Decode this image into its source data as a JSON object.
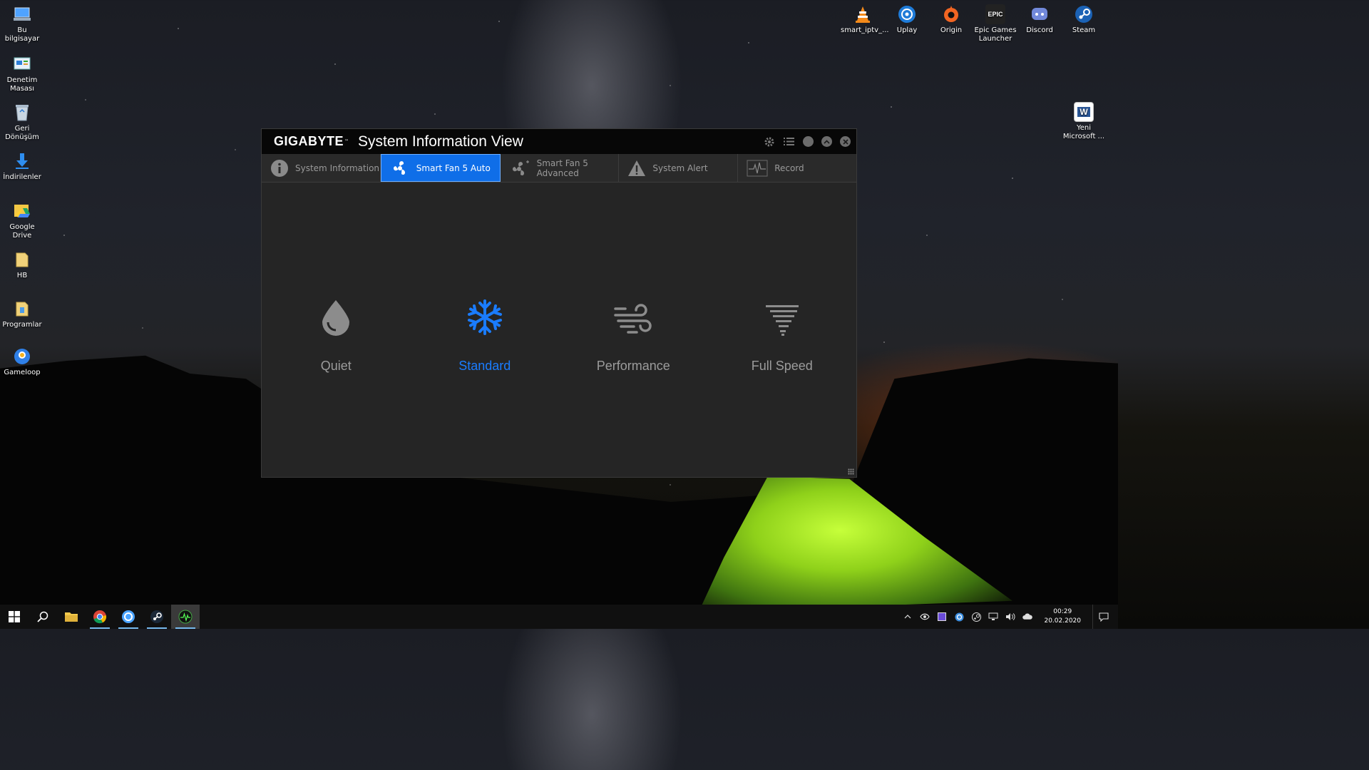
{
  "desktop": {
    "left_icons": [
      {
        "label": "Bu bilgisayar",
        "icon": "computer-icon"
      },
      {
        "label": "Denetim Masası",
        "icon": "control-panel-icon"
      },
      {
        "label": "Geri Dönüşüm",
        "icon": "recycle-bin-icon"
      },
      {
        "label": "İndirilenler",
        "icon": "downloads-icon"
      },
      {
        "label": "Google Drive",
        "icon": "google-drive-icon"
      },
      {
        "label": "HB",
        "icon": "folder-icon"
      },
      {
        "label": "Programlar",
        "icon": "folder-icon"
      },
      {
        "label": "Gameloop",
        "icon": "gameloop-icon"
      }
    ],
    "top_icons": [
      {
        "label": "smart_iptv_...",
        "icon": "vlc-icon"
      },
      {
        "label": "Uplay",
        "icon": "uplay-icon"
      },
      {
        "label": "Origin",
        "icon": "origin-icon"
      },
      {
        "label": "Epic Games Launcher",
        "icon": "epic-games-icon",
        "glyph": "EPIC"
      },
      {
        "label": "Discord",
        "icon": "discord-icon"
      },
      {
        "label": "Steam",
        "icon": "steam-icon"
      }
    ],
    "word_icon": {
      "label": "Yeni Microsoft ...",
      "icon": "word-document-icon",
      "glyph": "W"
    }
  },
  "window": {
    "brand": "GIGABYTE",
    "brand_mark": "™",
    "title": "System Information View",
    "controls": [
      "settings-icon",
      "list-icon",
      "minimize-button",
      "maximize-button",
      "close-button"
    ],
    "tabs": [
      {
        "label": "System Information",
        "icon": "info-icon",
        "active": false
      },
      {
        "label": "Smart Fan 5 Auto",
        "icon": "fan-icon",
        "active": true
      },
      {
        "label": "Smart Fan 5 Advanced",
        "icon": "fan-advanced-icon",
        "active": false
      },
      {
        "label": "System Alert",
        "icon": "warning-icon",
        "active": false
      },
      {
        "label": "Record",
        "icon": "pulse-icon",
        "active": false
      }
    ],
    "modes": [
      {
        "label": "Quiet",
        "icon": "droplet-icon",
        "selected": false
      },
      {
        "label": "Standard",
        "icon": "snowflake-icon",
        "selected": true
      },
      {
        "label": "Performance",
        "icon": "wind-icon",
        "selected": false
      },
      {
        "label": "Full Speed",
        "icon": "tornado-icon",
        "selected": false
      }
    ],
    "colors": {
      "accent": "#0f6ee8",
      "selected_text": "#1a7cff",
      "inactive_text": "#9b9b9b",
      "window_bg": "#252525"
    }
  },
  "taskbar": {
    "pinned": [
      "windows-start-icon",
      "search-icon",
      "file-explorer-icon",
      "chrome-icon",
      "uplay-icon",
      "steam-icon",
      "system-info-view-icon"
    ],
    "tray": [
      "chevron-up-icon",
      "nvidia-icon",
      "app-tray-icon",
      "uplay-tray-icon",
      "steam-tray-icon",
      "network-icon",
      "volume-icon",
      "cloud-icon"
    ],
    "time": "00:29",
    "date": "20.02.2020"
  }
}
